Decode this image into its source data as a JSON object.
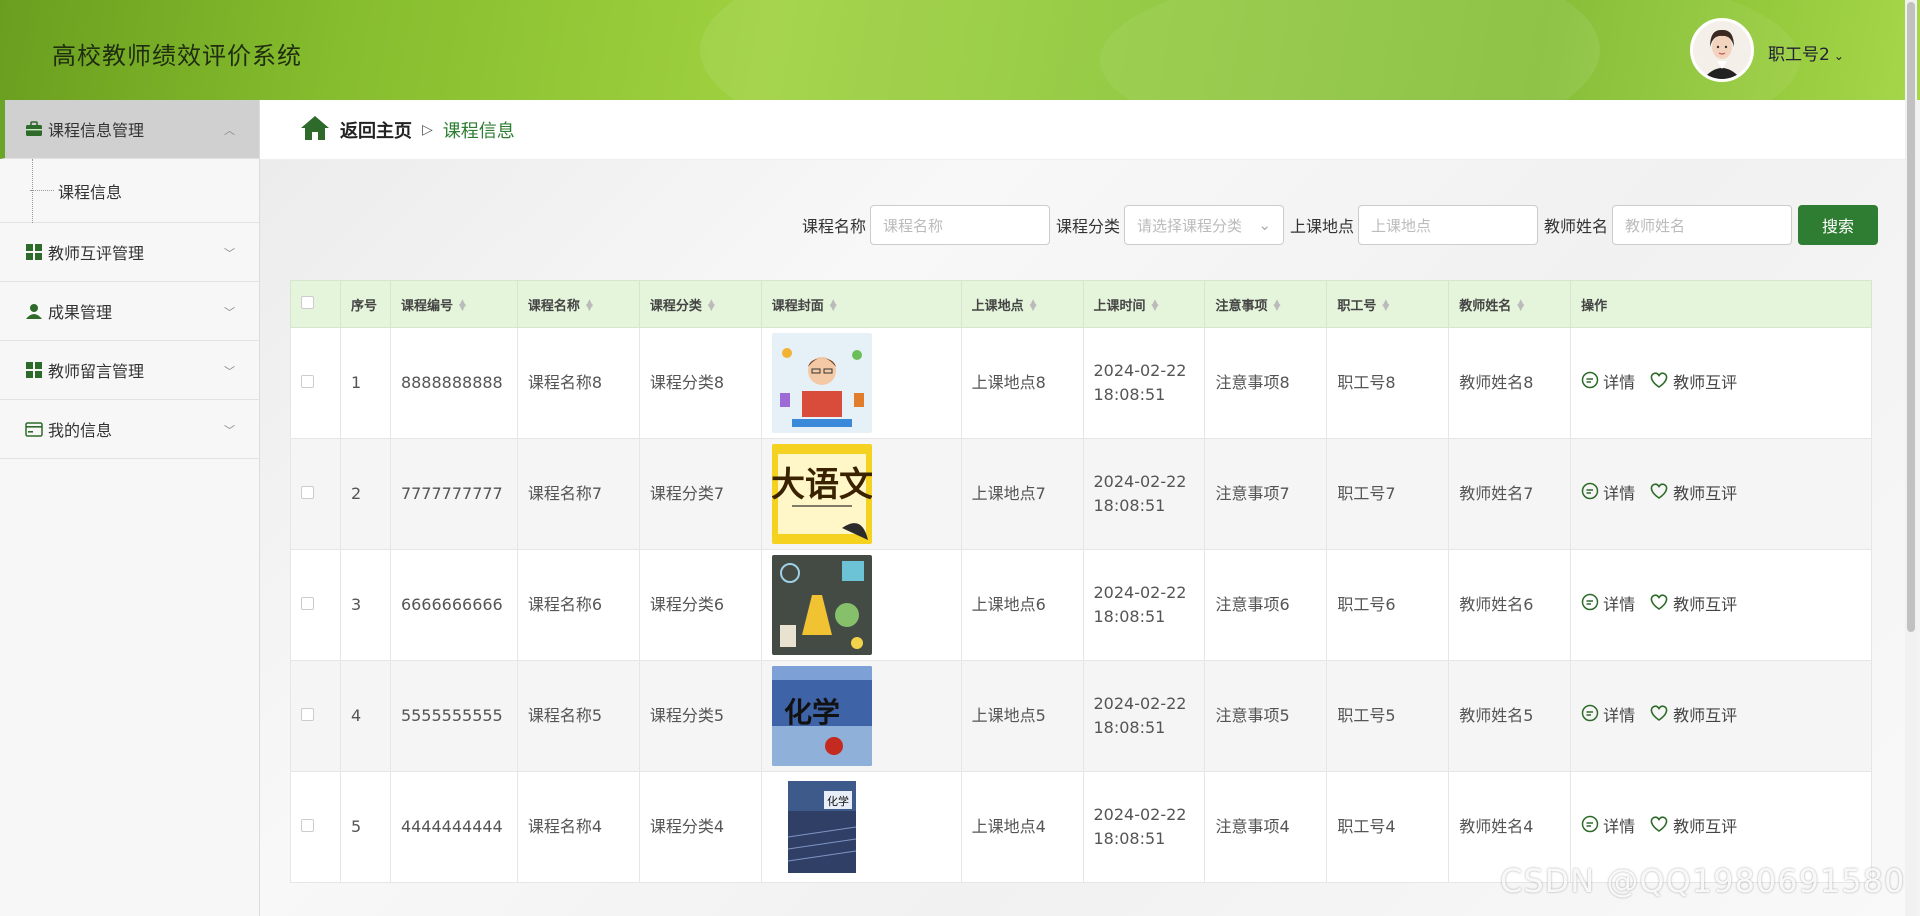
{
  "app": {
    "title": "高校教师绩效评价系统"
  },
  "user": {
    "name": "职工号2"
  },
  "sidebar": {
    "items": [
      {
        "label": "课程信息管理",
        "icon": "briefcase-icon",
        "expanded": true
      },
      {
        "label": "教师互评管理",
        "icon": "grid-icon"
      },
      {
        "label": "成果管理",
        "icon": "person-icon"
      },
      {
        "label": "教师留言管理",
        "icon": "grid-icon"
      },
      {
        "label": "我的信息",
        "icon": "card-icon"
      }
    ],
    "sub": {
      "label": "课程信息"
    }
  },
  "breadcrumb": {
    "home": "返回主页",
    "current": "课程信息"
  },
  "search": {
    "name_label": "课程名称",
    "name_placeholder": "课程名称",
    "category_label": "课程分类",
    "category_placeholder": "请选择课程分类",
    "location_label": "上课地点",
    "location_placeholder": "上课地点",
    "teacher_label": "教师姓名",
    "teacher_placeholder": "教师姓名",
    "button": "搜索"
  },
  "table": {
    "headers": [
      "序号",
      "课程编号",
      "课程名称",
      "课程分类",
      "课程封面",
      "上课地点",
      "上课时间",
      "注意事项",
      "职工号",
      "教师姓名",
      "操作"
    ],
    "detail_label": "详情",
    "review_label": "教师互评",
    "rows": [
      {
        "no": "1",
        "code": "8888888888",
        "name": "课程名称8",
        "category": "课程分类8",
        "cover": "teacher-reading",
        "location": "上课地点8",
        "date": "2024-02-22",
        "time": "18:08:51",
        "note": "注意事项8",
        "staff": "职工号8",
        "teacher": "教师姓名8"
      },
      {
        "no": "2",
        "code": "7777777777",
        "name": "课程名称7",
        "category": "课程分类7",
        "cover": "chinese-book",
        "location": "上课地点7",
        "date": "2024-02-22",
        "time": "18:08:51",
        "note": "注意事项7",
        "staff": "职工号7",
        "teacher": "教师姓名7"
      },
      {
        "no": "3",
        "code": "6666666666",
        "name": "课程名称6",
        "category": "课程分类6",
        "cover": "science-lab",
        "location": "上课地点6",
        "date": "2024-02-22",
        "time": "18:08:51",
        "note": "注意事项6",
        "staff": "职工号6",
        "teacher": "教师姓名6"
      },
      {
        "no": "4",
        "code": "5555555555",
        "name": "课程名称5",
        "category": "课程分类5",
        "cover": "chemistry-book",
        "location": "上课地点5",
        "date": "2024-02-22",
        "time": "18:08:51",
        "note": "注意事项5",
        "staff": "职工号5",
        "teacher": "教师姓名5"
      },
      {
        "no": "5",
        "code": "4444444444",
        "name": "课程名称4",
        "category": "课程分类4",
        "cover": "chemistry-book-2",
        "location": "上课地点4",
        "date": "2024-02-22",
        "time": "18:08:51",
        "note": "注意事项4",
        "staff": "职工号4",
        "teacher": "教师姓名4"
      }
    ]
  },
  "watermark": "CSDN @QQ1980691580",
  "colors": {
    "accent": "#2e7d32",
    "header": "#8cc637",
    "table_header": "#e5f5db"
  }
}
